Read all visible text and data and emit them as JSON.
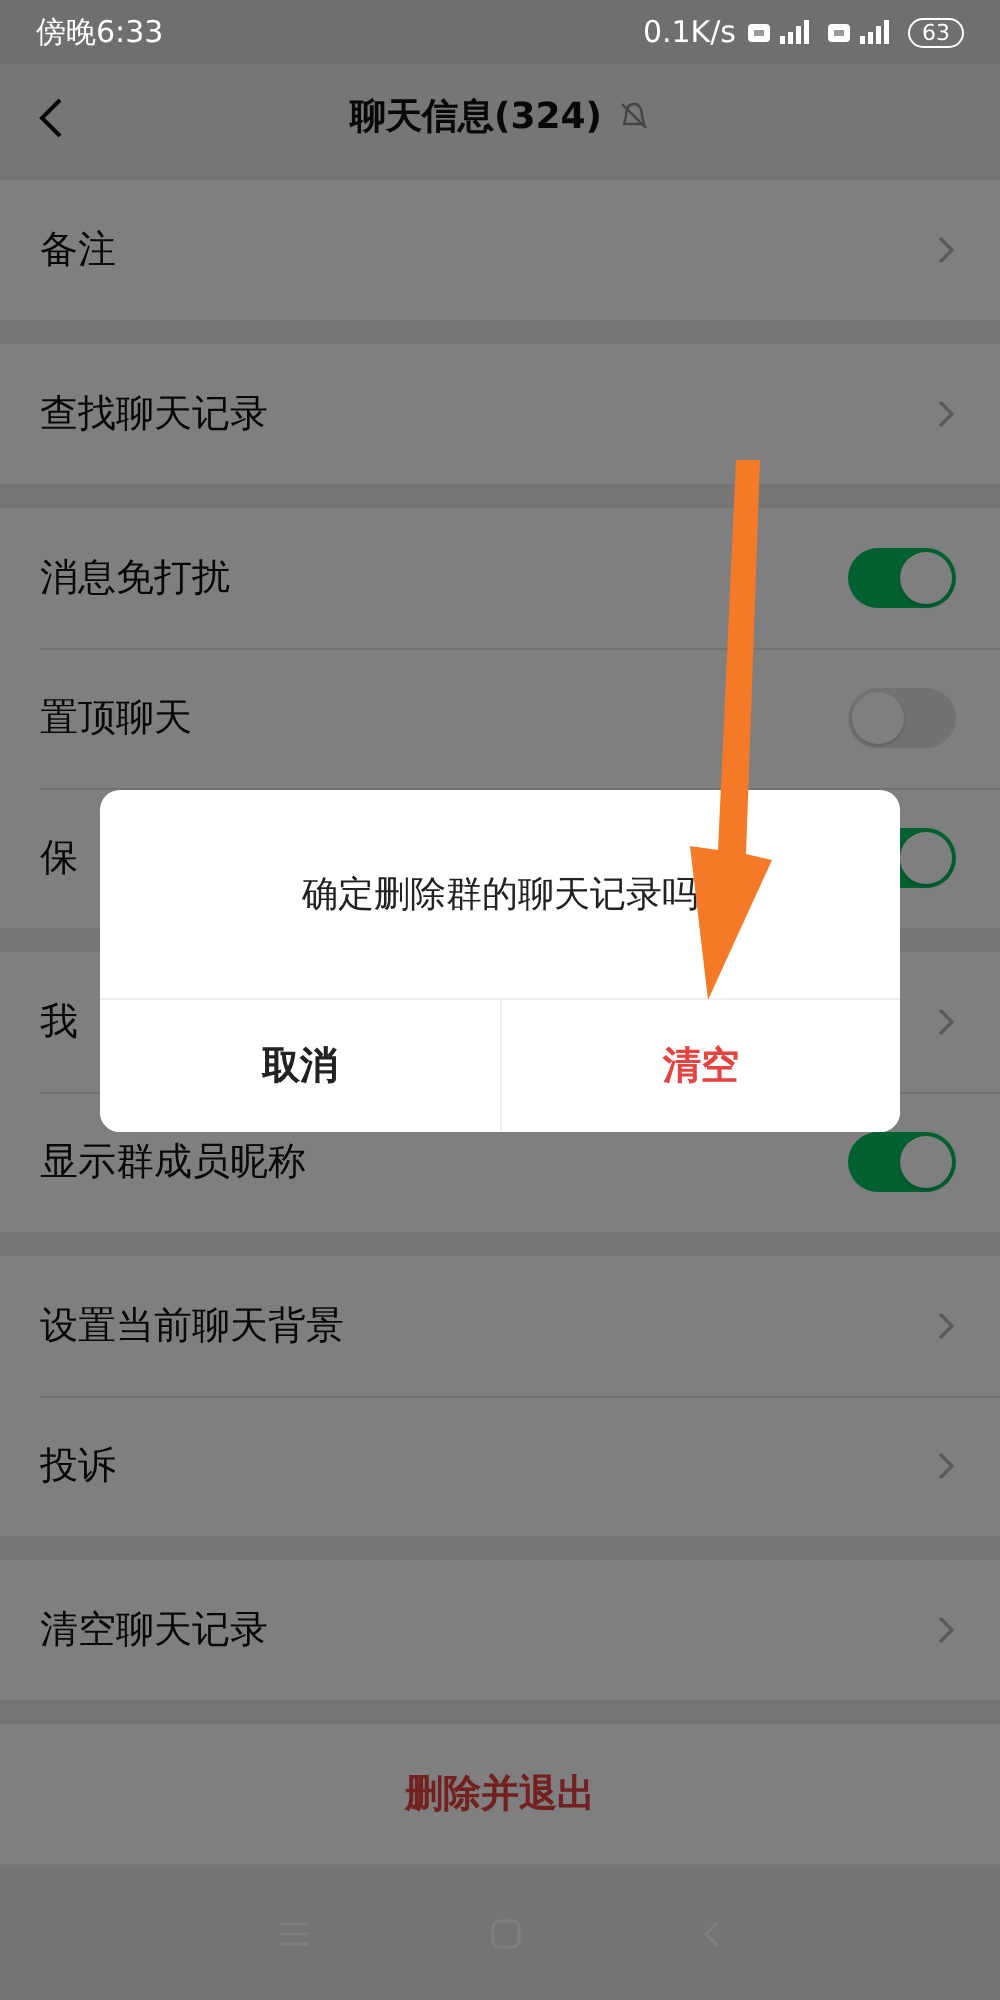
{
  "status_bar": {
    "time": "傍晚6:33",
    "speed": "0.1K/s",
    "battery": "63"
  },
  "header": {
    "title": "聊天信息(324)",
    "muted": true
  },
  "groups": [
    [
      {
        "kind": "link",
        "label": "备注"
      }
    ],
    [
      {
        "kind": "link",
        "label": "查找聊天记录"
      }
    ],
    [
      {
        "kind": "toggle",
        "label": "消息免打扰",
        "on": true
      },
      {
        "kind": "toggle",
        "label": "置顶聊天",
        "on": false
      },
      {
        "kind": "toggle",
        "label": "保",
        "on": true
      }
    ],
    [
      {
        "kind": "link",
        "label": "我"
      },
      {
        "kind": "toggle",
        "label": "显示群成员昵称",
        "on": true
      }
    ],
    [
      {
        "kind": "link",
        "label": "设置当前聊天背景"
      },
      {
        "kind": "link",
        "label": "投诉"
      }
    ],
    [
      {
        "kind": "link",
        "label": "清空聊天记录"
      }
    ]
  ],
  "exit_button": "删除并退出",
  "dialog": {
    "message": "确定删除群的聊天记录吗",
    "buttons": [
      {
        "label": "取消",
        "kind": "cancel"
      },
      {
        "label": "清空",
        "kind": "danger"
      }
    ]
  }
}
